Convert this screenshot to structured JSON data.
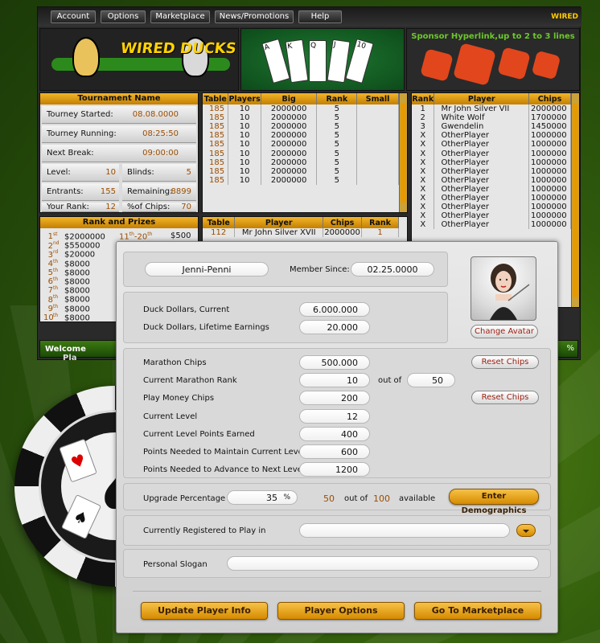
{
  "menu": {
    "items": [
      "Account",
      "Options",
      "Marketplace",
      "News/Promotions",
      "Help"
    ],
    "brand": "WIRED DUCKS"
  },
  "banner": {
    "logo_text": "WIRED DUCKS",
    "cards": [
      "A",
      "K",
      "Q",
      "J",
      "10"
    ],
    "sponsor": "Sponsor Hyperlink,up to 2 to 3 lines"
  },
  "tournament": {
    "title": "Tournament Name",
    "started_label": "Tourney Started:",
    "started": "08.08.0000",
    "running_label": "Tourney Running:",
    "running": "08:25:50",
    "break_label": "Next Break:",
    "break": "09:00:00",
    "level_label": "Level:",
    "level": "10",
    "blinds_label": "Blinds:",
    "blinds": "5",
    "entrants_label": "Entrants:",
    "entrants": "155",
    "remaining_label": "Remaining:",
    "remaining": "8899",
    "rank_label": "Your Rank:",
    "rank": "12",
    "chips_label": "%of Chips:",
    "chips_pct": "70"
  },
  "tables_list": {
    "headers": [
      "Table",
      "Players",
      "Big",
      "Rank",
      "Small"
    ],
    "rows": [
      [
        "185",
        "10",
        "2000000",
        "5",
        ""
      ],
      [
        "185",
        "10",
        "2000000",
        "5",
        ""
      ],
      [
        "185",
        "10",
        "2000000",
        "5",
        ""
      ],
      [
        "185",
        "10",
        "2000000",
        "5",
        ""
      ],
      [
        "185",
        "10",
        "2000000",
        "5",
        ""
      ],
      [
        "185",
        "10",
        "2000000",
        "5",
        ""
      ],
      [
        "185",
        "10",
        "2000000",
        "5",
        ""
      ],
      [
        "185",
        "10",
        "2000000",
        "5",
        ""
      ],
      [
        "185",
        "10",
        "2000000",
        "5",
        ""
      ]
    ]
  },
  "leaderboard": {
    "headers": [
      "Rank",
      "Player",
      "Chips"
    ],
    "rows": [
      [
        "1",
        "Mr John Silver VII",
        "2000000"
      ],
      [
        "2",
        "White Wolf",
        "1700000"
      ],
      [
        "3",
        "Gwendelin",
        "1450000"
      ],
      [
        "X",
        "OtherPlayer",
        "1000000"
      ],
      [
        "X",
        "OtherPlayer",
        "1000000"
      ],
      [
        "X",
        "OtherPlayer",
        "1000000"
      ],
      [
        "X",
        "OtherPlayer",
        "1000000"
      ],
      [
        "X",
        "OtherPlayer",
        "1000000"
      ],
      [
        "X",
        "OtherPlayer",
        "1000000"
      ],
      [
        "X",
        "OtherPlayer",
        "1000000"
      ],
      [
        "X",
        "OtherPlayer",
        "1000000"
      ],
      [
        "X",
        "OtherPlayer",
        "1000000"
      ],
      [
        "X",
        "OtherPlayer",
        "1000000"
      ],
      [
        "X",
        "OtherPlayer",
        "1000000"
      ]
    ]
  },
  "prizes": {
    "title": "Rank and Prizes",
    "rows": [
      {
        "n": "1",
        "suf": "st",
        "amt": "$2000000"
      },
      {
        "n": "2",
        "suf": "nd",
        "amt": "$550000"
      },
      {
        "n": "3",
        "suf": "rd",
        "amt": "$20000"
      },
      {
        "n": "4",
        "suf": "th",
        "amt": "$8000"
      },
      {
        "n": "5",
        "suf": "th",
        "amt": "$8000"
      },
      {
        "n": "6",
        "suf": "th",
        "amt": "$8000"
      },
      {
        "n": "7",
        "suf": "th",
        "amt": "$8000"
      },
      {
        "n": "8",
        "suf": "th",
        "amt": "$8000"
      },
      {
        "n": "9",
        "suf": "th",
        "amt": "$8000"
      },
      {
        "n": "10",
        "suf": "th",
        "amt": "$8000"
      }
    ],
    "range": {
      "from": "11",
      "from_suf": "th",
      "to": "20",
      "to_suf": "th",
      "amt": "$500"
    }
  },
  "table_players": {
    "headers": [
      "Table",
      "Player",
      "Chips",
      "Rank"
    ],
    "row": [
      "112",
      "Mr John Silver XVII",
      "2000000",
      "1"
    ]
  },
  "welcome": {
    "label": "Welcome",
    "partial": "Pla"
  },
  "green_right": "%",
  "profile": {
    "username": "Jenni-Penni",
    "member_since_label": "Member Since:",
    "member_since": "02.25.0000",
    "change_avatar": "Change Avatar",
    "duck_current_label": "Duck Dollars, Current",
    "duck_current": "6.000.000",
    "duck_lifetime_label": "Duck Dollars, Lifetime Earnings",
    "duck_lifetime": "20.000",
    "marathon_label": "Marathon Chips",
    "marathon": "500.000",
    "reset_chips": "Reset Chips",
    "rank_label": "Current Marathon Rank",
    "rank": "10",
    "out_of": "out of",
    "rank_total": "50",
    "play_money_label": "Play Money Chips",
    "play_money": "200",
    "level_label": "Current Level",
    "level": "12",
    "points_earned_label": "Current Level Points Earned",
    "points_earned": "400",
    "maintain_label": "Points Needed to Maintain Current Level",
    "maintain": "600",
    "advance_label": "Points Needed to Advance to Next Level",
    "advance": "1200",
    "upgrade_label": "Upgrade Percentage",
    "upgrade": "35",
    "percent_sign": "%",
    "upgrade_count": "50",
    "upgrade_total": "100",
    "available": "available",
    "demographics": "Enter Demographics",
    "registered_label": "Currently Registered to Play in",
    "registered": "",
    "slogan_label": "Personal Slogan",
    "slogan": ""
  },
  "actions": {
    "update": "Update Player Info",
    "options": "Player Options",
    "market": "Go To Marketplace"
  },
  "colors": {
    "accent": "#f3b52b",
    "rank_text": "#9b4d00",
    "reset_text": "#9b1d10"
  }
}
